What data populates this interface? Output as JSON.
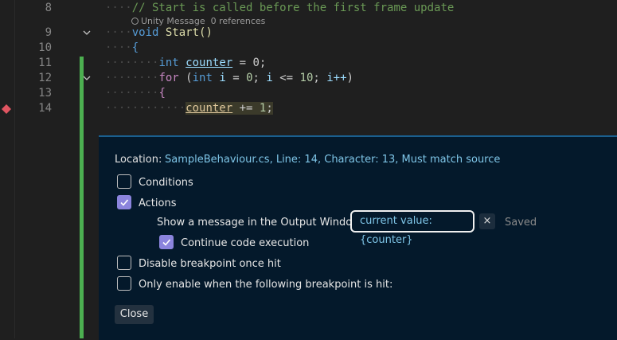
{
  "editor": {
    "line_numbers": [
      "8",
      "9",
      "10",
      "11",
      "12",
      "13",
      "14"
    ],
    "comment_text": "// Start is called before the first frame update",
    "codelens_message": "Unity Message",
    "codelens_refs": "0 references",
    "kw_void": "void",
    "fn_start": "Start()",
    "open_brace": "{",
    "kw_int": "int",
    "counter_name": "counter",
    "assign_zero": " = 0;",
    "kw_for": "for",
    "for_open": " (",
    "for_int": "int",
    "for_i": "i",
    "for_eq": " = ",
    "for_zero": "0",
    "for_sep": "; ",
    "for_i2": "i",
    "for_le": " <= ",
    "for_ten": "10",
    "for_sep2": "; ",
    "for_inc": "i++",
    "for_close": ")",
    "inner_brace": "{",
    "counter_ref": "counter",
    "plus_eq": " += ",
    "one": "1",
    "semicolon": ";",
    "breakpoint_color": "#e05561",
    "change_bar_color": "#4caf50"
  },
  "breakpoint_settings": {
    "location_label": "Location:",
    "location_value": "SampleBehaviour.cs, Line: 14, Character: 13, Must match source",
    "conditions": {
      "label": "Conditions",
      "checked": false
    },
    "actions": {
      "label": "Actions",
      "checked": true
    },
    "message_label": "Show a message in the Output Window:",
    "message_value": "current value: {counter}",
    "clear_icon": "×",
    "saved_text": "Saved",
    "continue": {
      "label": "Continue code execution",
      "checked": true
    },
    "disable_once_hit": {
      "label": "Disable breakpoint once hit",
      "checked": false
    },
    "only_enable": {
      "label": "Only enable when the following breakpoint is hit:",
      "checked": false
    },
    "close_label": "Close",
    "accent_color": "#8b84dd"
  }
}
